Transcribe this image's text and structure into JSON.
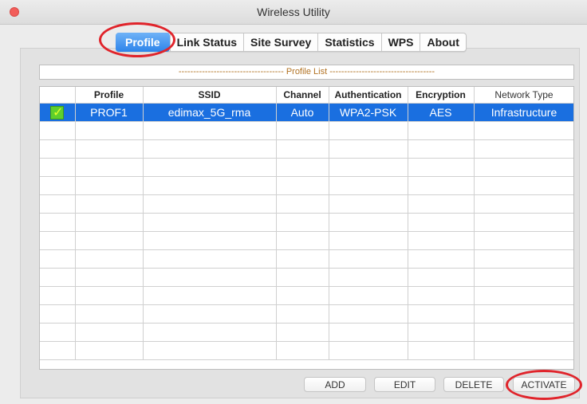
{
  "window": {
    "title": "Wireless Utility"
  },
  "tabs": [
    {
      "label": "Profile",
      "active": true
    },
    {
      "label": "Link Status",
      "active": false
    },
    {
      "label": "Site Survey",
      "active": false
    },
    {
      "label": "Statistics",
      "active": false
    },
    {
      "label": "WPS",
      "active": false
    },
    {
      "label": "About",
      "active": false
    }
  ],
  "profile_list": {
    "caption": "------------------------------------ Profile List ------------------------------------",
    "columns": [
      "",
      "Profile",
      "SSID",
      "Channel",
      "Authentication",
      "Encryption",
      "Network Type"
    ],
    "rows": [
      {
        "active_icon": "check-icon",
        "profile": "PROF1",
        "ssid": "edimax_5G_rma",
        "channel": "Auto",
        "authentication": "WPA2-PSK",
        "encryption": "AES",
        "network_type": "Infrastructure"
      }
    ]
  },
  "buttons": {
    "add": "ADD",
    "edit": "EDIT",
    "delete": "DELETE",
    "activate": "ACTIVATE"
  },
  "colors": {
    "selected_row": "#1a6fe0",
    "active_tab": "#2d84ea",
    "highlight_ellipse": "#e0242b",
    "close_button": "#f25d5a"
  }
}
